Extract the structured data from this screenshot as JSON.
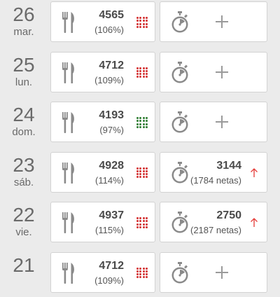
{
  "colors": {
    "over": "#d32f2f",
    "under": "#2e7d32",
    "icon": "#8a8a8a",
    "arrow": "#e53935"
  },
  "days": [
    {
      "day": "26",
      "weekday": "mar.",
      "kcal": "4565",
      "percent": "(106%)",
      "grid": "over",
      "activity": null
    },
    {
      "day": "25",
      "weekday": "lun.",
      "kcal": "4712",
      "percent": "(109%)",
      "grid": "over",
      "activity": null
    },
    {
      "day": "24",
      "weekday": "dom.",
      "kcal": "4193",
      "percent": "(97%)",
      "grid": "under",
      "activity": null
    },
    {
      "day": "23",
      "weekday": "sáb.",
      "kcal": "4928",
      "percent": "(114%)",
      "grid": "over",
      "activity": {
        "value": "3144",
        "net": "(1784 netas)"
      }
    },
    {
      "day": "22",
      "weekday": "vie.",
      "kcal": "4937",
      "percent": "(115%)",
      "grid": "over",
      "activity": {
        "value": "2750",
        "net": "(2187 netas)"
      }
    },
    {
      "day": "21",
      "weekday": "",
      "kcal": "4712",
      "percent": "(109%)",
      "grid": "over",
      "activity": null
    }
  ]
}
